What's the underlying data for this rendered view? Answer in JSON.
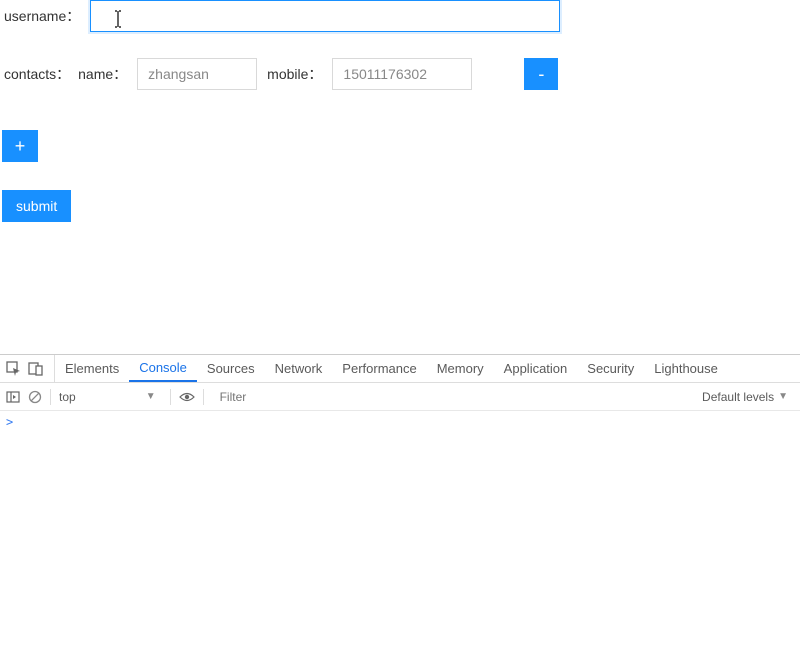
{
  "form": {
    "username_label": "username：",
    "username_value": "",
    "contacts_label": "contacts：",
    "name_label": "name：",
    "name_value": "zhangsan",
    "mobile_label": "mobile：",
    "mobile_value": "15011176302",
    "minus_label": "-",
    "plus_label": "+",
    "submit_label": "submit"
  },
  "devtools": {
    "tabs": {
      "elements": "Elements",
      "console": "Console",
      "sources": "Sources",
      "network": "Network",
      "performance": "Performance",
      "memory": "Memory",
      "application": "Application",
      "security": "Security",
      "lighthouse": "Lighthouse"
    },
    "toolbar": {
      "context": "top",
      "filter_placeholder": "Filter",
      "levels": "Default levels"
    },
    "prompt": ">"
  }
}
